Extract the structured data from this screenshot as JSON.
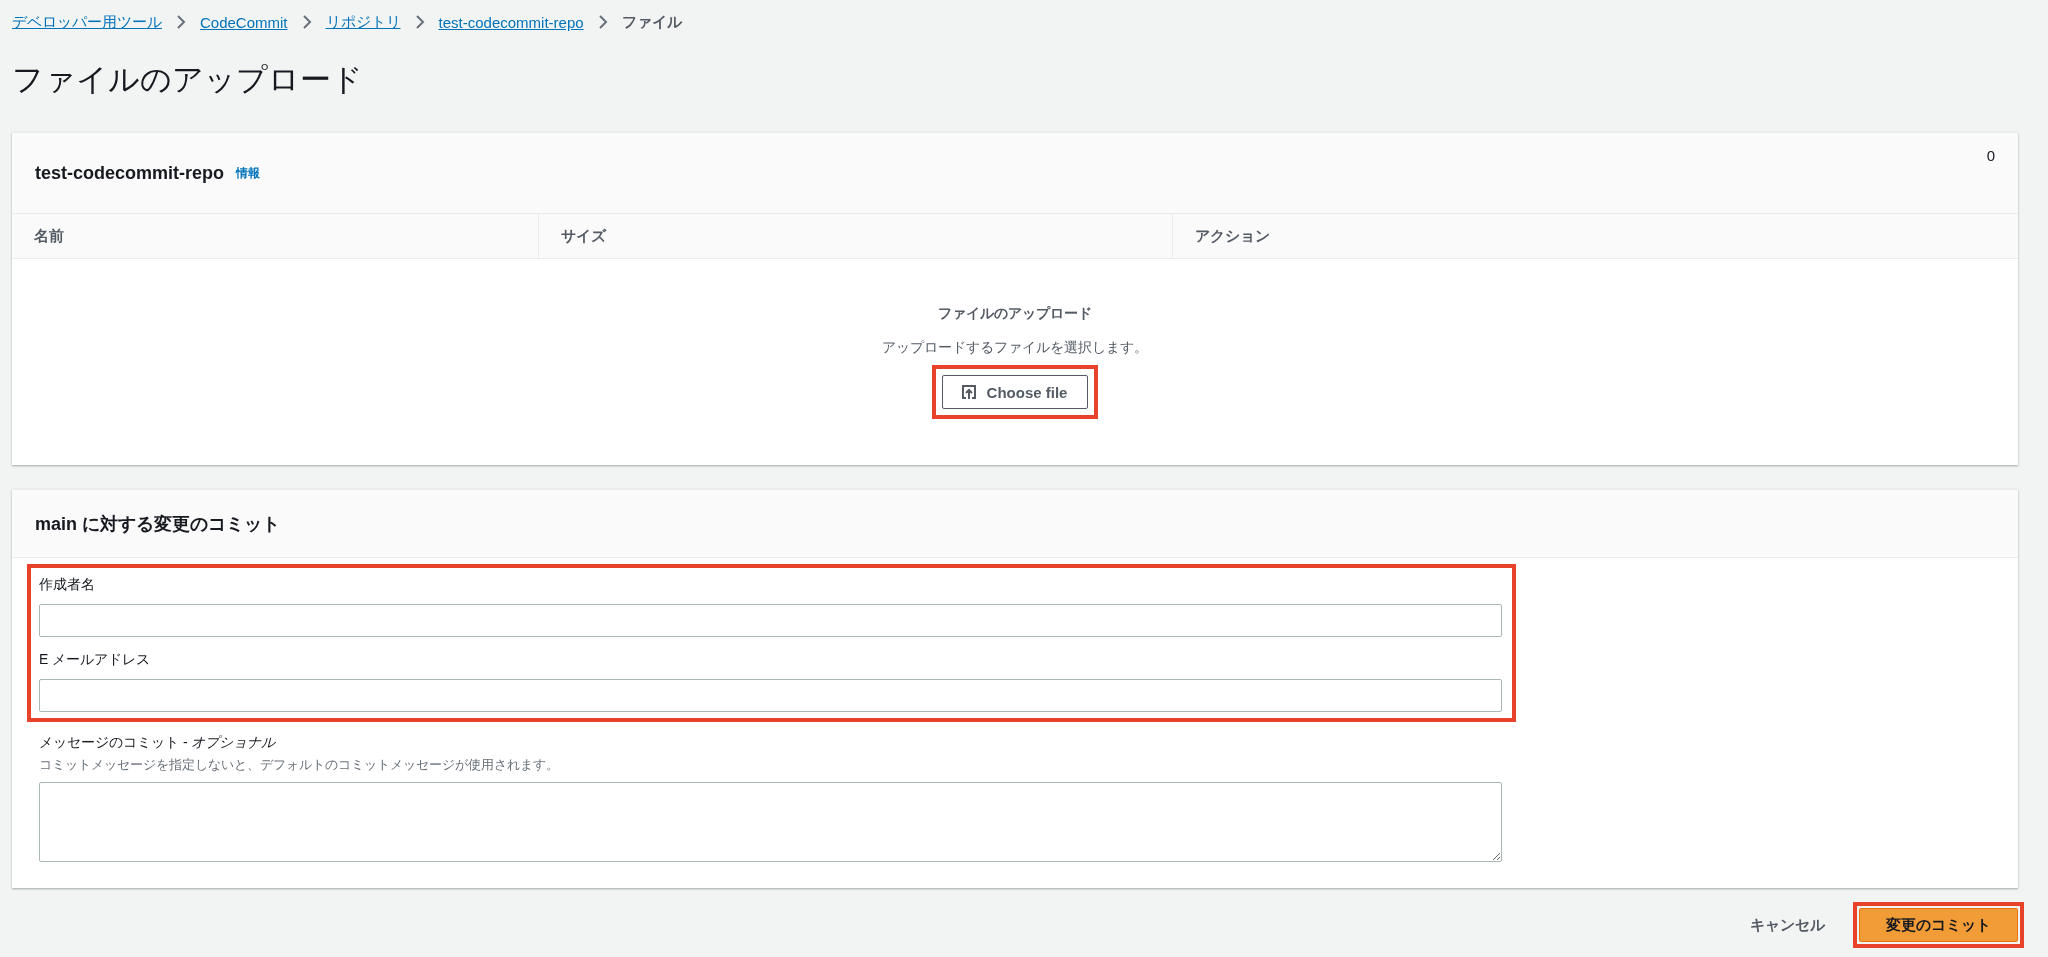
{
  "breadcrumbs": [
    {
      "label": "デベロッパー用ツール",
      "link": true
    },
    {
      "label": "CodeCommit",
      "link": true
    },
    {
      "label": "リポジトリ",
      "link": true
    },
    {
      "label": "test-codecommit-repo",
      "link": true
    },
    {
      "label": "ファイル",
      "link": false
    }
  ],
  "page_title": "ファイルのアップロード",
  "files_panel": {
    "title": "test-codecommit-repo",
    "info_link": "情報",
    "count": "0",
    "columns": [
      "名前",
      "サイズ",
      "アクション"
    ],
    "empty_title": "ファイルのアップロード",
    "empty_text": "アップロードするファイルを選択します。",
    "choose_button": {
      "label": "Choose file",
      "highlighted": true
    }
  },
  "commit_panel": {
    "title": "main に対する変更のコミット",
    "identity_highlighted": true,
    "fields": [
      {
        "label": "作成者名"
      },
      {
        "label": "E メールアドレス"
      }
    ],
    "message": {
      "label": "メッセージのコミット - *オプショナル*",
      "hint": "コミットメッセージを指定しないと、デフォルトのコミットメッセージが使用されます。"
    }
  },
  "actions": {
    "cancel": "キャンセル",
    "submit": {
      "label": "変更のコミット",
      "highlighted": true
    }
  }
}
